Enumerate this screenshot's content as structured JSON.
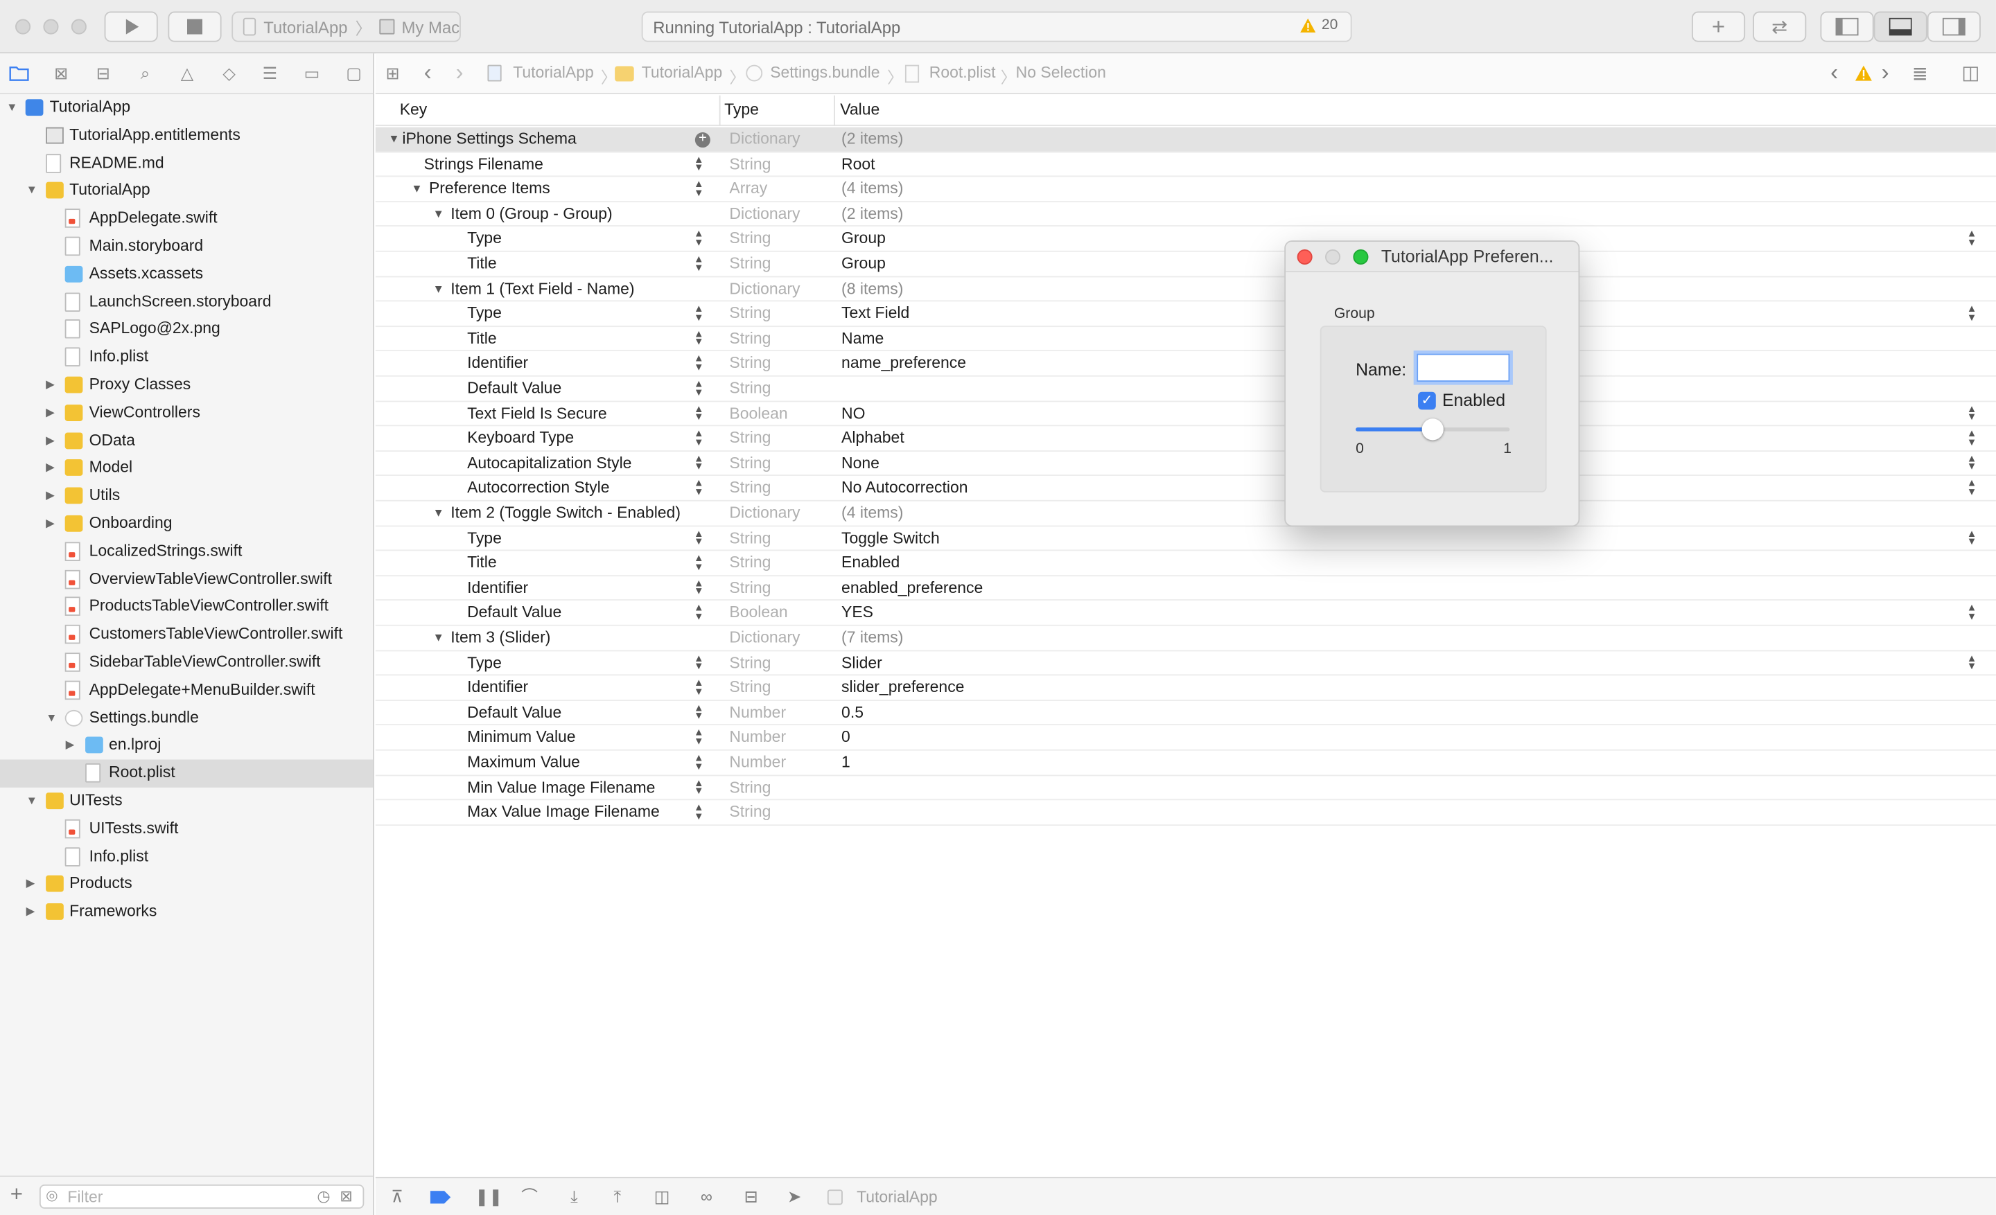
{
  "toolbar": {
    "scheme_project": "TutorialApp",
    "scheme_destination": "My Mac",
    "activity_status": "Running TutorialApp : TutorialApp",
    "warning_count": "20",
    "icons": [
      "play-icon",
      "stop-icon",
      "plus-icon",
      "swap-icon",
      "left-panel-icon",
      "bottom-panel-icon",
      "right-panel-icon"
    ]
  },
  "navigator": {
    "tree": [
      {
        "label": "TutorialApp",
        "depth": 0,
        "icon": "proj",
        "disclosure": "open"
      },
      {
        "label": "TutorialApp.entitlements",
        "depth": 1,
        "icon": "ent",
        "disclosure": ""
      },
      {
        "label": "README.md",
        "depth": 1,
        "icon": "file",
        "disclosure": ""
      },
      {
        "label": "TutorialApp",
        "depth": 1,
        "icon": "folder",
        "disclosure": "open"
      },
      {
        "label": "AppDelegate.swift",
        "depth": 2,
        "icon": "swift",
        "disclosure": ""
      },
      {
        "label": "Main.storyboard",
        "depth": 2,
        "icon": "file",
        "disclosure": ""
      },
      {
        "label": "Assets.xcassets",
        "depth": 2,
        "icon": "folder-blue",
        "disclosure": ""
      },
      {
        "label": "LaunchScreen.storyboard",
        "depth": 2,
        "icon": "file",
        "disclosure": ""
      },
      {
        "label": "SAPLogo@2x.png",
        "depth": 2,
        "icon": "file",
        "disclosure": ""
      },
      {
        "label": "Info.plist",
        "depth": 2,
        "icon": "file",
        "disclosure": ""
      },
      {
        "label": "Proxy Classes",
        "depth": 2,
        "icon": "folder",
        "disclosure": "closed"
      },
      {
        "label": "ViewControllers",
        "depth": 2,
        "icon": "folder",
        "disclosure": "closed"
      },
      {
        "label": "OData",
        "depth": 2,
        "icon": "folder",
        "disclosure": "closed"
      },
      {
        "label": "Model",
        "depth": 2,
        "icon": "folder",
        "disclosure": "closed"
      },
      {
        "label": "Utils",
        "depth": 2,
        "icon": "folder",
        "disclosure": "closed"
      },
      {
        "label": "Onboarding",
        "depth": 2,
        "icon": "folder",
        "disclosure": "closed"
      },
      {
        "label": "LocalizedStrings.swift",
        "depth": 2,
        "icon": "swift",
        "disclosure": ""
      },
      {
        "label": "OverviewTableViewController.swift",
        "depth": 2,
        "icon": "swift",
        "disclosure": ""
      },
      {
        "label": "ProductsTableViewController.swift",
        "depth": 2,
        "icon": "swift",
        "disclosure": ""
      },
      {
        "label": "CustomersTableViewController.swift",
        "depth": 2,
        "icon": "swift",
        "disclosure": ""
      },
      {
        "label": "SidebarTableViewController.swift",
        "depth": 2,
        "icon": "swift",
        "disclosure": ""
      },
      {
        "label": "AppDelegate+MenuBuilder.swift",
        "depth": 2,
        "icon": "swift",
        "disclosure": ""
      },
      {
        "label": "Settings.bundle",
        "depth": 2,
        "icon": "bundle",
        "disclosure": "open"
      },
      {
        "label": "en.lproj",
        "depth": 3,
        "icon": "folder-blue",
        "disclosure": "closed"
      },
      {
        "label": "Root.plist",
        "depth": 3,
        "icon": "file",
        "disclosure": "",
        "selected": true
      },
      {
        "label": "UITests",
        "depth": 1,
        "icon": "folder",
        "disclosure": "open"
      },
      {
        "label": "UITests.swift",
        "depth": 2,
        "icon": "swift",
        "disclosure": ""
      },
      {
        "label": "Info.plist",
        "depth": 2,
        "icon": "file",
        "disclosure": ""
      },
      {
        "label": "Products",
        "depth": 1,
        "icon": "folder",
        "disclosure": "closed"
      },
      {
        "label": "Frameworks",
        "depth": 1,
        "icon": "folder",
        "disclosure": "closed"
      }
    ],
    "filter_placeholder": "Filter"
  },
  "jumpbar": {
    "crumbs": [
      "TutorialApp",
      "TutorialApp",
      "Settings.bundle",
      "Root.plist",
      "No Selection"
    ]
  },
  "plist": {
    "headers": {
      "key": "Key",
      "type": "Type",
      "value": "Value"
    },
    "rows": [
      {
        "key": "iPhone Settings Schema",
        "type": "Dictionary",
        "value": "(2 items)",
        "level": 0,
        "disc": "open",
        "sel": true,
        "plus": true,
        "vmuted": true
      },
      {
        "key": "Strings Filename",
        "type": "String",
        "value": "Root",
        "level": 1,
        "disc": ""
      },
      {
        "key": "Preference Items",
        "type": "Array",
        "value": "(4 items)",
        "level": 1,
        "disc": "open",
        "vmuted": true
      },
      {
        "key": "Item 0 (Group - Group)",
        "type": "Dictionary",
        "value": "(2 items)",
        "level": 2,
        "disc": "open",
        "vmuted": true,
        "nostep": true
      },
      {
        "key": "Type",
        "type": "String",
        "value": "Group",
        "level": 3,
        "disc": "",
        "rstep": true
      },
      {
        "key": "Title",
        "type": "String",
        "value": "Group",
        "level": 3,
        "disc": ""
      },
      {
        "key": "Item 1 (Text Field - Name)",
        "type": "Dictionary",
        "value": "(8 items)",
        "level": 2,
        "disc": "open",
        "vmuted": true,
        "nostep": true
      },
      {
        "key": "Type",
        "type": "String",
        "value": "Text Field",
        "level": 3,
        "disc": "",
        "rstep": true
      },
      {
        "key": "Title",
        "type": "String",
        "value": "Name",
        "level": 3,
        "disc": ""
      },
      {
        "key": "Identifier",
        "type": "String",
        "value": "name_preference",
        "level": 3,
        "disc": ""
      },
      {
        "key": "Default Value",
        "type": "String",
        "value": "",
        "level": 3,
        "disc": ""
      },
      {
        "key": "Text Field Is Secure",
        "type": "Boolean",
        "value": "NO",
        "level": 3,
        "disc": "",
        "rstep": true
      },
      {
        "key": "Keyboard Type",
        "type": "String",
        "value": "Alphabet",
        "level": 3,
        "disc": "",
        "rstep": true
      },
      {
        "key": "Autocapitalization Style",
        "type": "String",
        "value": "None",
        "level": 3,
        "disc": "",
        "rstep": true
      },
      {
        "key": "Autocorrection Style",
        "type": "String",
        "value": "No Autocorrection",
        "level": 3,
        "disc": "",
        "rstep": true
      },
      {
        "key": "Item 2 (Toggle Switch - Enabled)",
        "type": "Dictionary",
        "value": "(4 items)",
        "level": 2,
        "disc": "open",
        "vmuted": true,
        "nostep": true
      },
      {
        "key": "Type",
        "type": "String",
        "value": "Toggle Switch",
        "level": 3,
        "disc": "",
        "rstep": true
      },
      {
        "key": "Title",
        "type": "String",
        "value": "Enabled",
        "level": 3,
        "disc": ""
      },
      {
        "key": "Identifier",
        "type": "String",
        "value": "enabled_preference",
        "level": 3,
        "disc": ""
      },
      {
        "key": "Default Value",
        "type": "Boolean",
        "value": "YES",
        "level": 3,
        "disc": "",
        "rstep": true
      },
      {
        "key": "Item 3 (Slider)",
        "type": "Dictionary",
        "value": "(7 items)",
        "level": 2,
        "disc": "open",
        "vmuted": true,
        "nostep": true
      },
      {
        "key": "Type",
        "type": "String",
        "value": "Slider",
        "level": 3,
        "disc": "",
        "rstep": true
      },
      {
        "key": "Identifier",
        "type": "String",
        "value": "slider_preference",
        "level": 3,
        "disc": ""
      },
      {
        "key": "Default Value",
        "type": "Number",
        "value": "0.5",
        "level": 3,
        "disc": ""
      },
      {
        "key": "Minimum Value",
        "type": "Number",
        "value": "0",
        "level": 3,
        "disc": ""
      },
      {
        "key": "Maximum Value",
        "type": "Number",
        "value": "1",
        "level": 3,
        "disc": ""
      },
      {
        "key": "Min Value Image Filename",
        "type": "String",
        "value": "",
        "level": 3,
        "disc": ""
      },
      {
        "key": "Max Value Image Filename",
        "type": "String",
        "value": "",
        "level": 3,
        "disc": ""
      }
    ]
  },
  "debugbar": {
    "target": "TutorialApp",
    "icons": [
      "hide-debug-icon",
      "breakpoints-icon",
      "pause-icon",
      "step-over-icon",
      "step-in-icon",
      "step-out-icon",
      "view-debugger-icon",
      "memory-graph-icon",
      "environment-icon",
      "location-icon"
    ]
  },
  "prefs_window": {
    "title": "TutorialApp Preferen...",
    "group_label": "Group",
    "name_label": "Name:",
    "name_value": "",
    "enabled_label": "Enabled",
    "enabled_checked": true,
    "slider_min": "0",
    "slider_max": "1",
    "slider_value": 0.5
  },
  "colors": {
    "accent": "#3b7ff2",
    "close": "#fe5f57",
    "zoom": "#28c840",
    "warning": "#f4b400"
  }
}
